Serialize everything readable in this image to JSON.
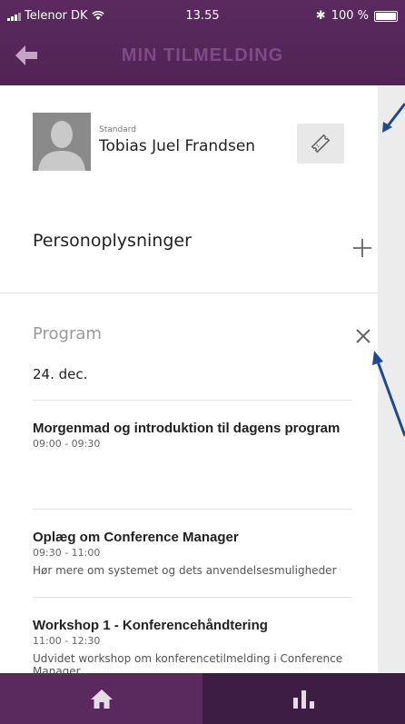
{
  "status_bar": {
    "carrier": "Telenor DK",
    "time": "13.55",
    "bluetooth": "✱",
    "battery": "100 %"
  },
  "header": {
    "title": "MIN TILMELDING",
    "back_icon": "arrow-left-icon"
  },
  "user": {
    "type": "Standard",
    "name": "Tobias Juel Frandsen"
  },
  "sections": {
    "personal": {
      "title": "Personoplysninger"
    },
    "program": {
      "title": "Program",
      "date": "24. dec.",
      "items": [
        {
          "title": "Morgenmad og introduktion til dagens program",
          "time": "09:00 - 09:30",
          "description": ""
        },
        {
          "title": "Oplæg om Conference Manager",
          "time": "09:30 - 11:00",
          "description": "Hør mere om systemet og dets anvendelsesmuligheder"
        },
        {
          "title": "Workshop 1 - Konferencehåndtering",
          "time": "11:00 - 12:30",
          "description": "Udvidet workshop om konferencetilmelding i Conference Manager"
        }
      ]
    }
  },
  "bottom_nav": {
    "home_icon": "home-icon",
    "stats_icon": "bar-chart-icon"
  },
  "colors": {
    "header": "#512455",
    "title": "#7f4a86",
    "back_arrow": "#c6a2c8",
    "bottom_bar": "#4a2350",
    "annotation_arrow": "#1f4a8a"
  }
}
